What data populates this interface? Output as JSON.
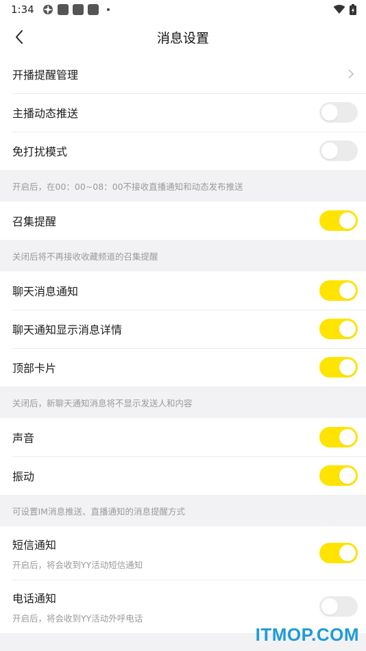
{
  "status_bar": {
    "time": "1:34"
  },
  "header": {
    "title": "消息设置"
  },
  "watermark": "ITMOP.COM",
  "sections": {
    "live": {
      "items": [
        {
          "label": "开播提醒管理",
          "type": "link"
        },
        {
          "label": "主播动态推送",
          "type": "toggle",
          "on": false
        },
        {
          "label": "免打扰模式",
          "type": "toggle",
          "on": false
        }
      ],
      "note": "开启后，在00：00~08：00不接收直播通知和动态发布推送"
    },
    "gather": {
      "items": [
        {
          "label": "召集提醒",
          "type": "toggle",
          "on": true
        }
      ],
      "note": "关闭后将不再接收收藏频道的召集提醒"
    },
    "chat": {
      "items": [
        {
          "label": "聊天消息通知",
          "type": "toggle",
          "on": true
        },
        {
          "label": "聊天通知显示消息详情",
          "type": "toggle",
          "on": true
        },
        {
          "label": "顶部卡片",
          "type": "toggle",
          "on": true
        }
      ],
      "note": "关闭后，新聊天通知消息将不显示发送人和内容"
    },
    "alert": {
      "items": [
        {
          "label": "声音",
          "type": "toggle",
          "on": true
        },
        {
          "label": "振动",
          "type": "toggle",
          "on": true
        }
      ],
      "note": "可设置IM消息推送、直播通知的消息提醒方式"
    },
    "external": {
      "items": [
        {
          "label": "短信通知",
          "sub": "开启后，将会收到YY活动短信通知",
          "type": "toggle",
          "on": true
        },
        {
          "label": "电话通知",
          "sub": "开启后，将会收到YY活动外呼电话",
          "type": "toggle",
          "on": false
        }
      ]
    }
  },
  "colors": {
    "toggle_on": "#ffe400",
    "toggle_off": "#ebebeb",
    "background": "#f2f2f4",
    "note_text": "#9a9a9a",
    "watermark": "#1f9ad6"
  }
}
